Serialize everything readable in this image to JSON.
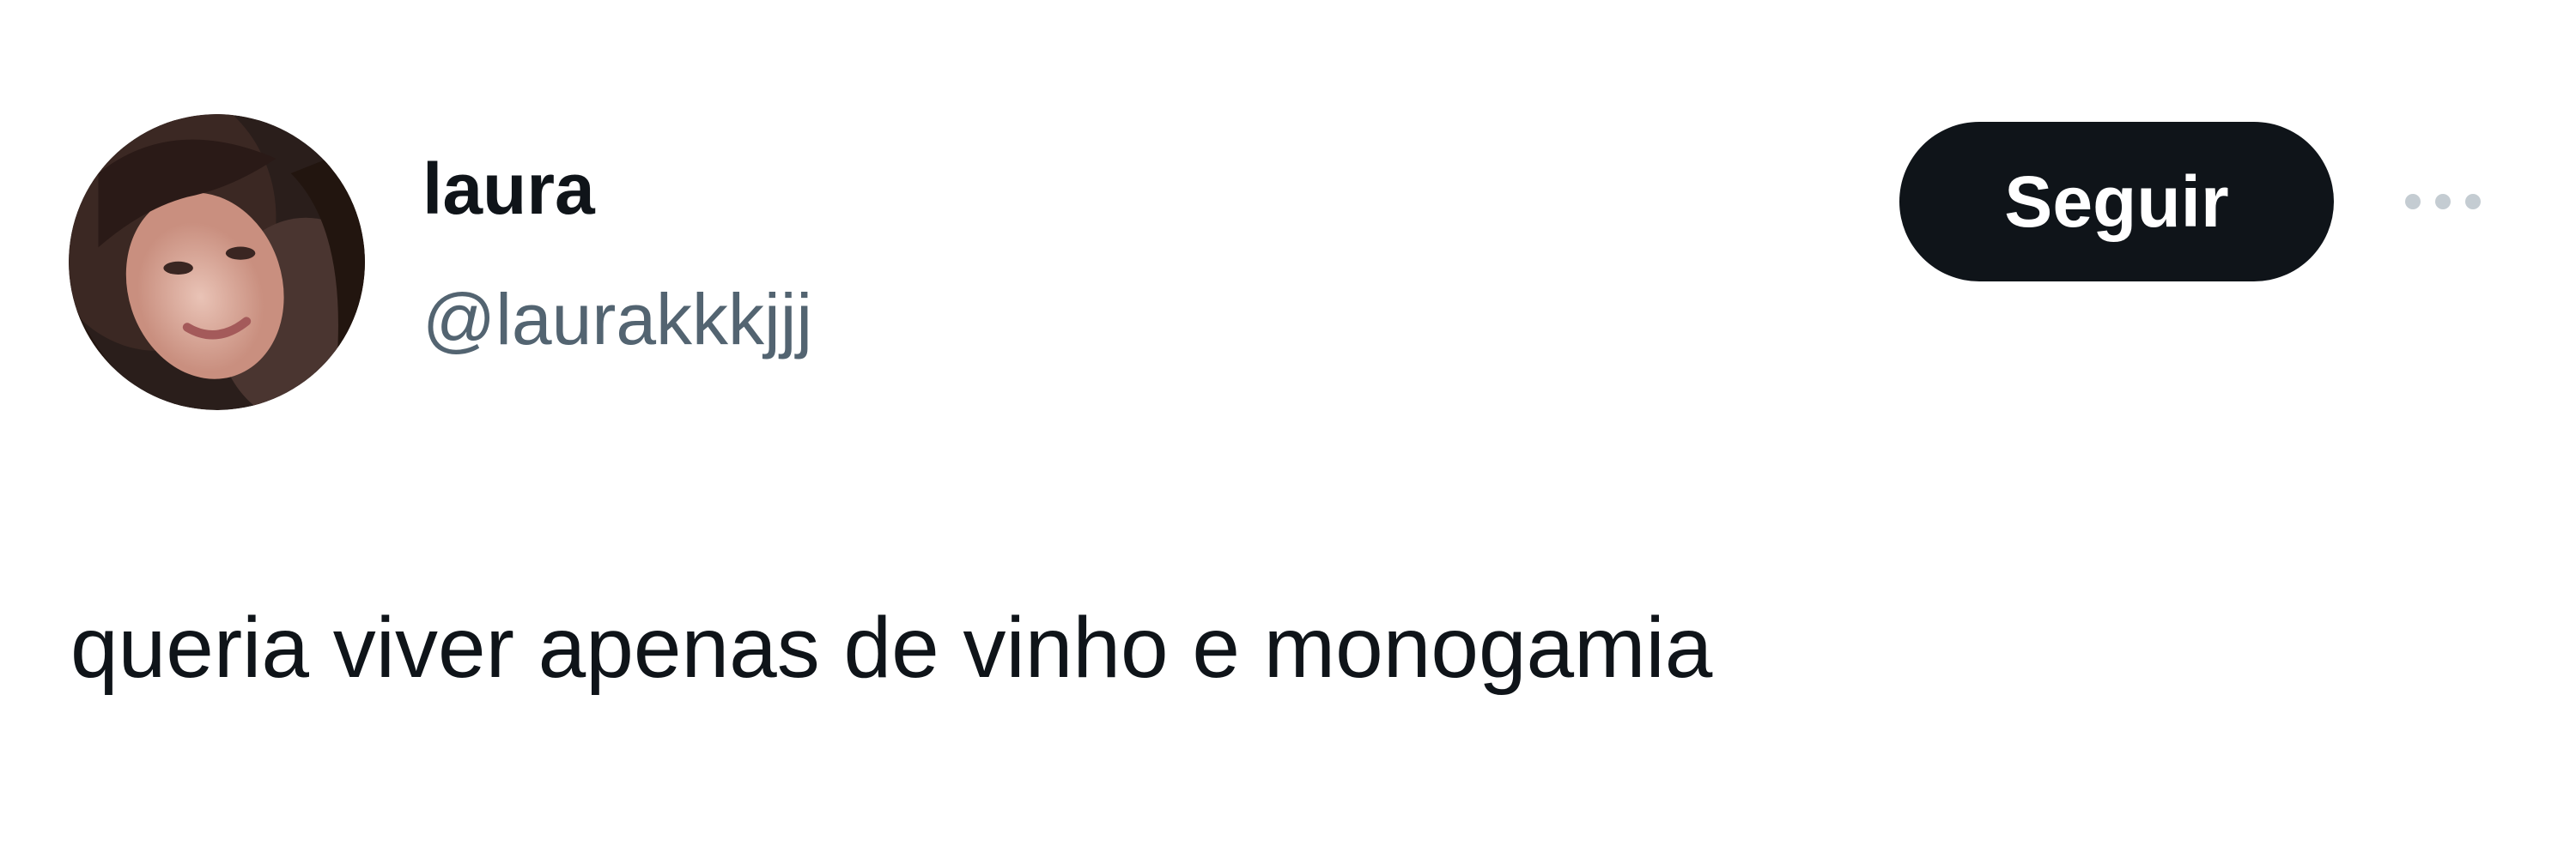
{
  "author": {
    "display_name": "laura",
    "handle": "@laurakkkjjj"
  },
  "actions": {
    "follow_label": "Seguir",
    "more_icon": "more-horizontal-icon"
  },
  "tweet": {
    "text": "queria viver apenas de vinho e monogamia"
  },
  "colors": {
    "text_primary": "#0f1419",
    "text_secondary": "#536471",
    "follow_button_bg": "#0f1419",
    "follow_button_text": "#ffffff"
  }
}
